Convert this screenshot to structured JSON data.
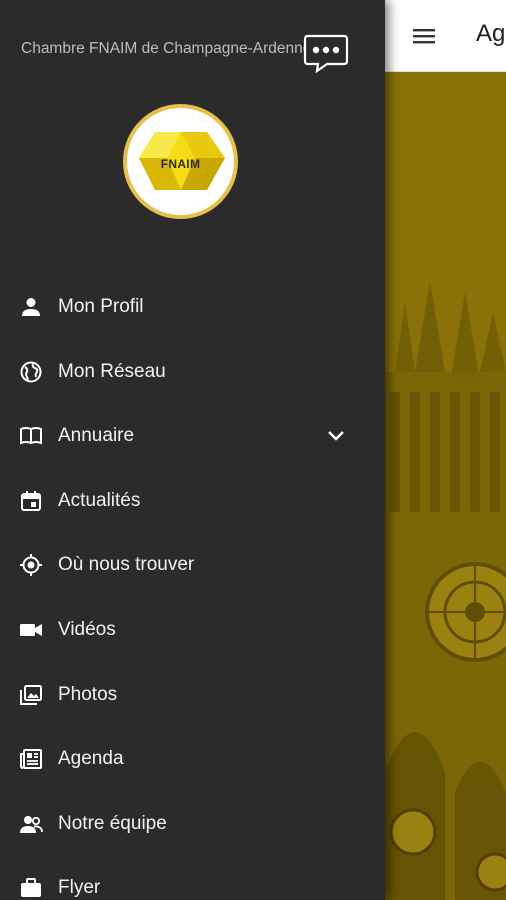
{
  "app": {
    "title_partial": "Ag"
  },
  "drawer": {
    "org_name": "Chambre FNAIM de Champagne-Ardenne",
    "logo_text": "FNAIM",
    "items": [
      {
        "label": "Mon Profil",
        "icon": "person-icon"
      },
      {
        "label": "Mon Réseau",
        "icon": "globe-icon"
      },
      {
        "label": "Annuaire",
        "icon": "book-icon",
        "expandable": true
      },
      {
        "label": "Actualités",
        "icon": "calendar-icon"
      },
      {
        "label": "Où nous trouver",
        "icon": "location-target-icon"
      },
      {
        "label": "Vidéos",
        "icon": "videocam-icon"
      },
      {
        "label": "Photos",
        "icon": "photo-library-icon"
      },
      {
        "label": "Agenda",
        "icon": "newspaper-icon"
      },
      {
        "label": "Notre équipe",
        "icon": "people-icon"
      },
      {
        "label": "Flyer",
        "icon": "briefcase-icon"
      }
    ]
  },
  "colors": {
    "drawer_bg": "#2b2b2b",
    "accent_gold": "#e6c04a",
    "logo_yellow": "#f5dd16",
    "hero_tint": "#8b7308"
  }
}
